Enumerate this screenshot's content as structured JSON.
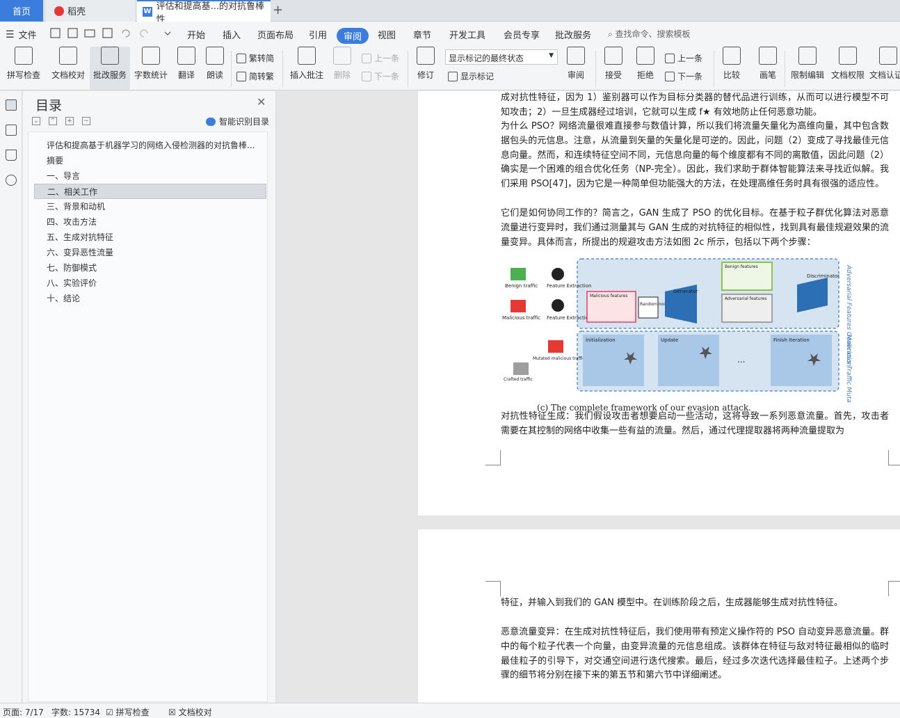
{
  "tabs": {
    "home": "首页",
    "daoke": "稻壳",
    "doc": "评估和提高基...的对抗鲁棒性",
    "plus": "+"
  },
  "menu": {
    "file": "文件",
    "items": [
      "开始",
      "插入",
      "页面布局",
      "引用",
      "审阅",
      "视图",
      "章节",
      "开发工具",
      "会员专享",
      "批改服务"
    ],
    "search": "查找命令、搜索模板"
  },
  "ribbon": {
    "spell": "拼写检查",
    "proof": "文档校对",
    "correct": "批改服务",
    "wordcount": "字数统计",
    "translate": "翻译",
    "read": "朗读",
    "trad": "繁转简",
    "simp": "简转繁",
    "insert_comment": "插入批注",
    "delete": "删除",
    "prev": "上一条",
    "next": "下一条",
    "track": "修订",
    "markup_state": "显示标记的最终状态",
    "show_markup": "显示标记",
    "review": "审阅",
    "accept": "接受",
    "reject": "拒绝",
    "prev2": "上一条",
    "next2": "下一条",
    "compare": "比较",
    "pen": "画笔",
    "restrict": "限制编辑",
    "perm": "文档权限",
    "auth": "文档认证"
  },
  "toc": {
    "title": "目录",
    "smart": "智能识别目录",
    "items": [
      "评估和提高基于机器学习的网络入侵检测器的对抗鲁棒...",
      "摘要",
      "一、导言",
      "二、相关工作",
      "三、背景和动机",
      "四、攻击方法",
      "五、生成对抗特征",
      "六、变异恶性流量",
      "七、防御模式",
      "八、实验评价",
      "十、结论"
    ]
  },
  "doc": {
    "p1": "成对抗性特征，因为 1）鉴别器可以作为目标分类器的替代品进行训练，从而可以进行模型不可知攻击；2）一旦生成器经过培训，它就可以生成 f★ 有效地防止任何恶意功能。",
    "p2": "为什么 PSO？网络流量很难直接参与数值计算，所以我们将流量矢量化为高维向量，其中包含数据包头的元信息。注意，从流量到矢量的矢量化是可逆的。因此，问题（2）变成了寻找最佳元信息向量。然而，和连续特征空间不同，元信息向量的每个维度都有不同的离散值，因此问题（2）确实是一个困难的组合优化任务（NP-完全）。因此，我们求助于群体智能算法来寻找近似解。我们采用 PSO[47]，因为它是一种简单但功能强大的方法，在处理高维任务时具有很强的适应性。",
    "p3": "它们是如何协同工作的？简言之，GAN 生成了 PSO 的优化目标。在基于粒子群优化算法对恶意流量进行变异时，我们通过测量其与 GAN 生成的对抗特征的相似性，找到具有最佳规避效果的流量变异。具体而言，所提出的规避攻击方法如图 2c 所示，包括以下两个步骤：",
    "caption": "(c) The complete framework of our evasion attack.",
    "p4": "对抗性特征生成：我们假设攻击者想要启动一些活动，这将导致一系列恶意流量。首先，攻击者需要在其控制的网络中收集一些有益的流量。然后，通过代理提取器将两种流量提取为",
    "p5": "特征，并输入到我们的 GAN 模型中。在训练阶段之后，生成器能够生成对抗性特征。",
    "p6": "恶意流量变异：在生成对抗性特征后，我们使用带有预定义操作符的 PSO 自动变异恶意流量。群中的每个粒子代表一个向量，由变异流量的元信息组成。该群体在特征与敌对特征最相似的临时最佳粒子的引导下，对交通空间进行迭代搜索。最后，经过多次迭代选择最佳粒子。上述两个步骤的细节将分别在接下来的第五节和第六节中详细阐述。"
  },
  "figure": {
    "benign": "Benign traffic",
    "malicious": "Malicious traffic",
    "fe1": "Feature Extraction",
    "fe2": "Feature Extraction",
    "malfeat": "Malicious features",
    "random": "Random noises",
    "generator": "Generator",
    "benfeat": "Benign features",
    "advfeat": "Adversarial features",
    "disc": "Discriminator",
    "gen_side": "Adversarial Features Generation",
    "mut_side": "Malicious Traffic Mutation",
    "mutated": "Mutated malicious traffic",
    "crafted": "Crafted traffic",
    "init": "Initialization",
    "update": "Update",
    "finish": "Finish Iteration",
    "dots": "..."
  },
  "status": {
    "page": "页面: 7/17",
    "words": "字数: 15734",
    "spell": "拼写检查",
    "proof": "文档校对"
  }
}
